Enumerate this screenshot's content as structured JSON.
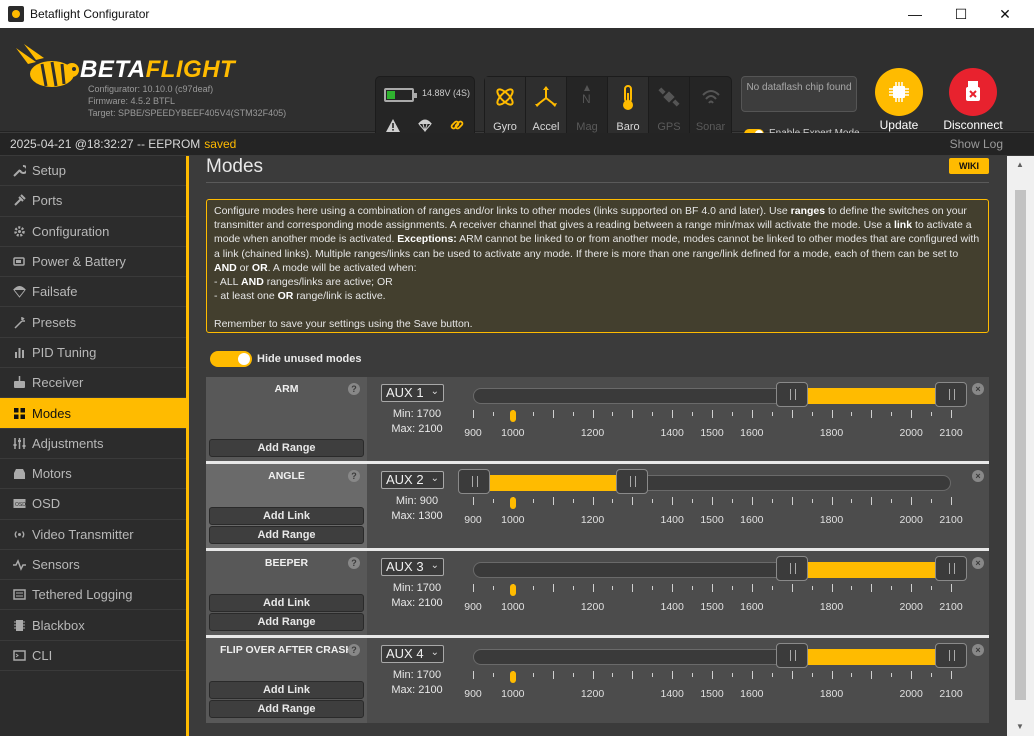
{
  "window": {
    "title": "Betaflight Configurator",
    "minimize": "—",
    "maximize": "☐",
    "close": "✕"
  },
  "header": {
    "logo_text_a": "BETA",
    "logo_text_b": "FLIGHT",
    "configurator": "Configurator: 10.10.0 (c97deaf)",
    "firmware": "Firmware: 4.5.2 BTFL",
    "target": "Target: SPBE/SPEEDYBEEF405V4(STM32F405)",
    "voltage": "14.88V (4S)",
    "battery_level": 0.3,
    "sensors": [
      {
        "label": "Gyro",
        "active": true
      },
      {
        "label": "Accel",
        "active": true
      },
      {
        "label": "Mag",
        "active": false
      },
      {
        "label": "Baro",
        "active": true
      },
      {
        "label": "GPS",
        "active": false
      },
      {
        "label": "Sonar",
        "active": false
      }
    ],
    "dataflash": "No dataflash chip found",
    "expert_mode": "Enable Expert Mode",
    "update_firmware": "Update Firmware",
    "disconnect": "Disconnect"
  },
  "statusbar": {
    "text": "2025-04-21 @18:32:27 -- EEPROM",
    "saved": "saved",
    "show_log": "Show Log"
  },
  "sidebar": {
    "items": [
      {
        "label": "Setup"
      },
      {
        "label": "Ports"
      },
      {
        "label": "Configuration"
      },
      {
        "label": "Power & Battery"
      },
      {
        "label": "Failsafe"
      },
      {
        "label": "Presets"
      },
      {
        "label": "PID Tuning"
      },
      {
        "label": "Receiver"
      },
      {
        "label": "Modes",
        "active": true
      },
      {
        "label": "Adjustments"
      },
      {
        "label": "Motors"
      },
      {
        "label": "OSD"
      },
      {
        "label": "Video Transmitter"
      },
      {
        "label": "Sensors"
      },
      {
        "label": "Tethered Logging"
      },
      {
        "label": "Blackbox"
      },
      {
        "label": "CLI"
      }
    ]
  },
  "page": {
    "title": "Modes",
    "wiki": "WIKI",
    "note": {
      "p1a": "Configure modes here using a combination of ranges and/or links to other modes (links supported on BF 4.0 and later). Use ",
      "p1b": "ranges",
      "p1c": " to define the switches on your transmitter and corresponding mode assignments. A receiver channel that gives a reading between a range min/max will activate the mode. Use a ",
      "p1d": "link",
      "p1e": " to activate a mode when another mode is activated. ",
      "p1f": "Exceptions:",
      "p1g": " ARM cannot be linked to or from another mode, modes cannot be linked to other modes that are configured with a link (chained links). Multiple ranges/links can be used to activate any mode. If there is more than one range/link defined for a mode, each of them can be set to ",
      "p1h": "AND",
      "p1i": " or ",
      "p1j": "OR",
      "p1k": ". A mode will be activated when:",
      "l1a": "- ALL ",
      "l1b": "AND",
      "l1c": " ranges/links are active; OR",
      "l2a": "- at least one ",
      "l2b": "OR",
      "l2c": " range/link is active.",
      "p2": "Remember to save your settings using the Save button."
    },
    "hide_unused": "Hide unused modes",
    "add_link": "Add Link",
    "add_range": "Add Range",
    "ticks": [
      "900",
      "1000",
      "1200",
      "1400",
      "1500",
      "1600",
      "1800",
      "2000",
      "2100"
    ]
  },
  "modes": [
    {
      "name": "ARM",
      "aux": "AUX 1",
      "min": "Min: 1700",
      "max": "Max: 2100",
      "range_min": 1700,
      "range_max": 2100,
      "channel": 1000,
      "has_link": false
    },
    {
      "name": "ANGLE",
      "aux": "AUX 2",
      "min": "Min: 900",
      "max": "Max: 1300",
      "range_min": 900,
      "range_max": 1300,
      "channel": 1000,
      "has_link": true
    },
    {
      "name": "BEEPER",
      "aux": "AUX 3",
      "min": "Min: 1700",
      "max": "Max: 2100",
      "range_min": 1700,
      "range_max": 2100,
      "channel": 1000,
      "has_link": true
    },
    {
      "name": "FLIP OVER AFTER CRASH",
      "aux": "AUX 4",
      "min": "Min: 1700",
      "max": "Max: 2100",
      "range_min": 1700,
      "range_max": 2100,
      "channel": 1000,
      "has_link": true
    }
  ],
  "colors": {
    "accent": "#ffbb00",
    "disconnect": "#e8222e"
  }
}
